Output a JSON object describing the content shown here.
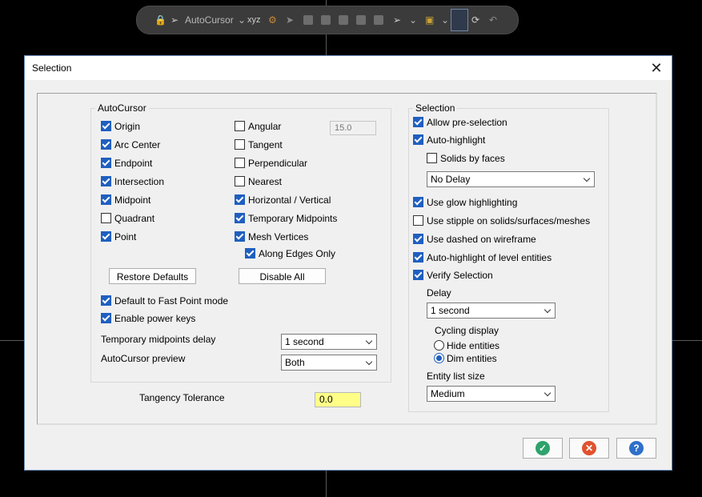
{
  "toolbar": {
    "autocursor_label": "AutoCursor",
    "xyz_label": "xyz",
    "icons": [
      "lock-icon",
      "cursor-select-icon",
      "chevron-down-icon",
      "xyz-icon",
      "settings-icon",
      "pointer-icon",
      "solid-icon",
      "box-icon",
      "cube-icon",
      "select-mode-icon",
      "chevron-down-icon",
      "marquee-icon",
      "chevron-down-icon",
      "glow-select-icon",
      "refresh-icon",
      "undo-icon"
    ]
  },
  "dialog": {
    "title": "Selection",
    "autocursor": {
      "title": "AutoCursor",
      "col1": [
        {
          "label": "Origin",
          "checked": true
        },
        {
          "label": "Arc Center",
          "checked": true
        },
        {
          "label": "Endpoint",
          "checked": true
        },
        {
          "label": "Intersection",
          "checked": true
        },
        {
          "label": "Midpoint",
          "checked": true
        },
        {
          "label": "Quadrant",
          "checked": false
        },
        {
          "label": "Point",
          "checked": true
        }
      ],
      "col2": [
        {
          "label": "Angular",
          "checked": false
        },
        {
          "label": "Tangent",
          "checked": false
        },
        {
          "label": "Perpendicular",
          "checked": false
        },
        {
          "label": "Nearest",
          "checked": false
        },
        {
          "label": "Horizontal / Vertical",
          "checked": true
        },
        {
          "label": "Temporary Midpoints",
          "checked": true
        },
        {
          "label": "Mesh Vertices",
          "checked": true
        }
      ],
      "along_edges": {
        "label": "Along Edges Only",
        "checked": true
      },
      "angular_value": "15.0",
      "restore_defaults": "Restore Defaults",
      "disable_all": "Disable All",
      "fast_point": {
        "label": "Default to Fast Point mode",
        "checked": true
      },
      "power_keys": {
        "label": "Enable power keys",
        "checked": true
      },
      "temp_midpoints_delay_label": "Temporary midpoints delay",
      "temp_midpoints_delay_value": "1 second",
      "preview_label": "AutoCursor preview",
      "preview_value": "Both"
    },
    "tangency": {
      "label": "Tangency Tolerance",
      "value": "0.0"
    },
    "selection": {
      "title": "Selection",
      "allow_preselection": {
        "label": "Allow pre-selection",
        "checked": true
      },
      "auto_highlight": {
        "label": "Auto-highlight",
        "checked": true
      },
      "solids_by_faces": {
        "label": "Solids by faces",
        "checked": false
      },
      "highlight_delay_value": "No Delay",
      "glow": {
        "label": "Use glow highlighting",
        "checked": true
      },
      "stipple": {
        "label": "Use stipple on solids/surfaces/meshes",
        "checked": false
      },
      "dashed": {
        "label": "Use dashed on wireframe",
        "checked": true
      },
      "level_entities": {
        "label": "Auto-highlight of level entities",
        "checked": true
      },
      "verify": {
        "label": "Verify Selection",
        "checked": true
      },
      "delay_label": "Delay",
      "delay_value": "1 second",
      "cycling_label": "Cycling display",
      "hide_entities": {
        "label": "Hide entities",
        "selected": false
      },
      "dim_entities": {
        "label": "Dim entities",
        "selected": true
      },
      "entity_list_size_label": "Entity list size",
      "entity_list_size_value": "Medium"
    },
    "footer": {
      "ok_icon": "check-icon",
      "cancel_icon": "cancel-x-icon",
      "help_icon": "help-question-icon",
      "help_glyph": "?"
    }
  },
  "colors": {
    "ok": "#2ea36b",
    "cancel": "#e0522e",
    "help": "#2e6fc9",
    "tangency_field": "#ffff88",
    "checkbox": "#1f5fbf"
  }
}
